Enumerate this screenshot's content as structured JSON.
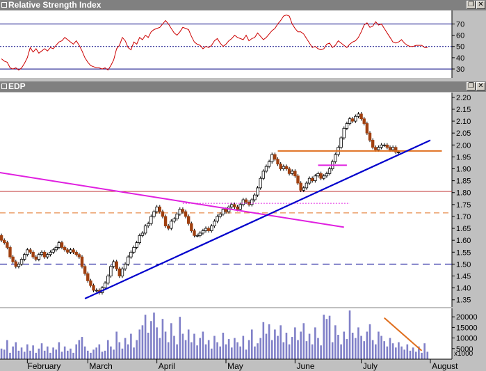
{
  "panes": {
    "rsi": {
      "title": "Relative Strength Index"
    },
    "price": {
      "title": "EDP"
    }
  },
  "window_buttons": {
    "restore": "❐",
    "close": "✕"
  },
  "colors": {
    "rsi_line": "#cc0000",
    "up_candle": "#ffffff",
    "down_candle": "#a04010",
    "trendline_blue": "#0000cc",
    "trendline_magenta": "#e020e0",
    "level_orange": "#e07020",
    "volume": "#8080c8"
  },
  "chart_data": [
    {
      "type": "line",
      "name": "rsi",
      "title": "Relative Strength Index",
      "ylim": [
        22,
        82
      ],
      "yticks": [
        "70",
        "60",
        "50",
        "40",
        "30"
      ],
      "ytick_values": [
        70,
        60,
        50,
        40,
        30
      ],
      "reference_lines": [
        {
          "value": 70,
          "style": "solid"
        },
        {
          "value": 50,
          "style": "dotted"
        },
        {
          "value": 30,
          "style": "solid"
        }
      ],
      "x": [
        1,
        2,
        3,
        4,
        5,
        6,
        7,
        8,
        9,
        10,
        11,
        12,
        13,
        14,
        15,
        16,
        17,
        18,
        19,
        20,
        21,
        22,
        23,
        24,
        25,
        26,
        27,
        28,
        29,
        30,
        31,
        32,
        33,
        34,
        35,
        36,
        37,
        38,
        39,
        40,
        41,
        42,
        43,
        44,
        45,
        46,
        47,
        48,
        49,
        50,
        51,
        52,
        53,
        54,
        55,
        56,
        57,
        58,
        59,
        60,
        61,
        62,
        63,
        64,
        65,
        66,
        67,
        68,
        69,
        70,
        71,
        72,
        73,
        74,
        75,
        76,
        77,
        78,
        79,
        80,
        81,
        82,
        83,
        84,
        85,
        86,
        87,
        88,
        89,
        90,
        91,
        92,
        93,
        94,
        95,
        96,
        97,
        98,
        99,
        100,
        101,
        102,
        103,
        104,
        105,
        106,
        107,
        108,
        109,
        110,
        111,
        112,
        113,
        114,
        115,
        116,
        117,
        118,
        119,
        120,
        121,
        122,
        123,
        124,
        125,
        126,
        127,
        128,
        129,
        130,
        131,
        132,
        133,
        134,
        135,
        136,
        137,
        138,
        139,
        140,
        141,
        142,
        143,
        144,
        145,
        146,
        147,
        148,
        149
      ],
      "values": [
        39,
        37,
        36,
        31,
        30,
        31,
        29,
        31,
        35,
        40,
        49,
        45,
        48,
        44,
        46,
        48,
        46,
        49,
        48,
        51,
        54,
        55,
        58,
        56,
        54,
        52,
        55,
        51,
        46,
        40,
        36,
        33,
        32,
        31,
        31,
        30,
        31,
        29,
        33,
        38,
        48,
        51,
        58,
        55,
        49,
        47,
        54,
        52,
        58,
        56,
        60,
        58,
        63,
        65,
        66,
        67,
        70,
        73,
        70,
        66,
        62,
        60,
        63,
        67,
        66,
        65,
        59,
        54,
        52,
        51,
        48,
        50,
        49,
        51,
        55,
        57,
        53,
        50,
        52,
        55,
        57,
        60,
        58,
        57,
        56,
        60,
        55,
        57,
        58,
        62,
        59,
        56,
        58,
        61,
        64,
        66,
        70,
        73,
        77,
        78,
        77,
        70,
        66,
        63,
        63,
        61,
        57,
        53,
        49,
        50,
        48,
        47,
        48,
        52,
        53,
        49,
        51,
        55,
        53,
        51,
        49,
        52,
        54,
        55,
        58,
        63,
        69,
        71,
        67,
        68,
        72,
        69,
        70,
        66,
        62,
        58,
        54,
        53,
        54,
        56,
        53,
        51,
        50,
        50,
        51,
        51,
        51,
        49,
        49
      ]
    },
    {
      "type": "candlestick",
      "name": "price",
      "title": "EDP",
      "ylim": [
        1.32,
        2.22
      ],
      "yticks": [
        "2.20",
        "2.15",
        "2.10",
        "2.05",
        "2.00",
        "1.95",
        "1.90",
        "1.85",
        "1.80",
        "1.75",
        "1.70",
        "1.65",
        "1.60",
        "1.55",
        "1.50",
        "1.45",
        "1.40",
        "1.35"
      ],
      "ytick_values": [
        2.2,
        2.15,
        2.1,
        2.05,
        2.0,
        1.95,
        1.9,
        1.85,
        1.8,
        1.75,
        1.7,
        1.65,
        1.6,
        1.55,
        1.5,
        1.45,
        1.4,
        1.35
      ],
      "x": [
        1,
        2,
        3,
        4,
        5,
        6,
        7,
        8,
        9,
        10,
        11,
        12,
        13,
        14,
        15,
        16,
        17,
        18,
        19,
        20,
        21,
        22,
        23,
        24,
        25,
        26,
        27,
        28,
        29,
        30,
        31,
        32,
        33,
        34,
        35,
        36,
        37,
        38,
        39,
        40,
        41,
        42,
        43,
        44,
        45,
        46,
        47,
        48,
        49,
        50,
        51,
        52,
        53,
        54,
        55,
        56,
        57,
        58,
        59,
        60,
        61,
        62,
        63,
        64,
        65,
        66,
        67,
        68,
        69,
        70,
        71,
        72,
        73,
        74,
        75,
        76,
        77,
        78,
        79,
        80,
        81,
        82,
        83,
        84,
        85,
        86,
        87,
        88,
        89,
        90,
        91,
        92,
        93,
        94,
        95,
        96,
        97,
        98,
        99,
        100,
        101,
        102,
        103,
        104,
        105,
        106,
        107,
        108,
        109,
        110,
        111,
        112,
        113,
        114,
        115,
        116,
        117,
        118,
        119,
        120,
        121,
        122,
        123,
        124,
        125,
        126,
        127,
        128,
        129,
        130,
        131,
        132,
        133,
        134,
        135,
        136,
        137,
        138,
        139,
        140,
        141,
        142,
        143,
        144,
        145,
        146,
        147,
        148,
        149
      ],
      "open": [
        1.62,
        1.6,
        1.59,
        1.57,
        1.53,
        1.51,
        1.49,
        1.5,
        1.52,
        1.54,
        1.56,
        1.55,
        1.53,
        1.52,
        1.54,
        1.55,
        1.53,
        1.54,
        1.55,
        1.56,
        1.57,
        1.59,
        1.57,
        1.56,
        1.55,
        1.56,
        1.55,
        1.54,
        1.53,
        1.49,
        1.46,
        1.43,
        1.41,
        1.39,
        1.39,
        1.38,
        1.4,
        1.42,
        1.45,
        1.49,
        1.51,
        1.48,
        1.45,
        1.48,
        1.5,
        1.53,
        1.55,
        1.57,
        1.59,
        1.62,
        1.63,
        1.66,
        1.67,
        1.7,
        1.72,
        1.74,
        1.72,
        1.7,
        1.66,
        1.65,
        1.68,
        1.69,
        1.71,
        1.73,
        1.72,
        1.7,
        1.67,
        1.64,
        1.62,
        1.62,
        1.63,
        1.64,
        1.65,
        1.64,
        1.66,
        1.68,
        1.7,
        1.71,
        1.73,
        1.72,
        1.74,
        1.75,
        1.74,
        1.73,
        1.75,
        1.77,
        1.76,
        1.75,
        1.77,
        1.79,
        1.82,
        1.86,
        1.89,
        1.91,
        1.93,
        1.96,
        1.94,
        1.92,
        1.9,
        1.91,
        1.9,
        1.88,
        1.89,
        1.87,
        1.84,
        1.81,
        1.82,
        1.84,
        1.86,
        1.85,
        1.87,
        1.88,
        1.86,
        1.87,
        1.88,
        1.9,
        1.93,
        1.96,
        1.99,
        2.03,
        2.07,
        2.09,
        2.11,
        2.1,
        2.12,
        2.13,
        2.11,
        2.09,
        2.05,
        2.02,
        1.99,
        1.98,
        1.99,
        2.0,
        2.0,
        1.99,
        1.98,
        1.99,
        1.97
      ],
      "close": [
        1.6,
        1.59,
        1.57,
        1.53,
        1.51,
        1.49,
        1.5,
        1.52,
        1.54,
        1.56,
        1.55,
        1.53,
        1.52,
        1.54,
        1.55,
        1.53,
        1.54,
        1.55,
        1.56,
        1.57,
        1.59,
        1.57,
        1.56,
        1.55,
        1.56,
        1.55,
        1.54,
        1.53,
        1.49,
        1.46,
        1.43,
        1.41,
        1.39,
        1.39,
        1.38,
        1.4,
        1.42,
        1.45,
        1.49,
        1.51,
        1.48,
        1.45,
        1.48,
        1.5,
        1.53,
        1.55,
        1.57,
        1.59,
        1.62,
        1.63,
        1.66,
        1.67,
        1.7,
        1.72,
        1.74,
        1.72,
        1.7,
        1.66,
        1.65,
        1.68,
        1.69,
        1.71,
        1.73,
        1.72,
        1.7,
        1.67,
        1.64,
        1.62,
        1.62,
        1.63,
        1.64,
        1.65,
        1.64,
        1.66,
        1.68,
        1.7,
        1.71,
        1.73,
        1.72,
        1.74,
        1.75,
        1.74,
        1.73,
        1.75,
        1.77,
        1.76,
        1.75,
        1.77,
        1.79,
        1.82,
        1.86,
        1.89,
        1.91,
        1.93,
        1.96,
        1.94,
        1.92,
        1.9,
        1.91,
        1.9,
        1.88,
        1.89,
        1.87,
        1.84,
        1.81,
        1.82,
        1.84,
        1.86,
        1.85,
        1.87,
        1.88,
        1.86,
        1.87,
        1.88,
        1.9,
        1.93,
        1.96,
        1.99,
        2.03,
        2.07,
        2.09,
        2.11,
        2.1,
        2.12,
        2.13,
        2.11,
        2.09,
        2.05,
        2.02,
        1.99,
        1.98,
        1.99,
        2.0,
        2.0,
        1.99,
        1.98,
        1.99,
        1.97,
        1.97
      ]
    },
    {
      "type": "bar",
      "name": "volume",
      "ylim": [
        0,
        24000
      ],
      "yticks": [
        "20000",
        "15000",
        "10000",
        "5000"
      ],
      "ytick_values": [
        20000,
        15000,
        10000,
        5000
      ],
      "scale_label": "x1000",
      "values": [
        5000,
        4500,
        9000,
        3000,
        6000,
        8000,
        4000,
        5500,
        3500,
        7000,
        4000,
        6500,
        3000,
        5000,
        7500,
        4000,
        6000,
        3000,
        5500,
        4500,
        8000,
        3500,
        6000,
        4000,
        5000,
        3000,
        7000,
        9000,
        10500,
        6000,
        4000,
        3000,
        4500,
        5500,
        7000,
        3500,
        4000,
        9000,
        6000,
        4500,
        13000,
        8000,
        5000,
        10000,
        7000,
        12000,
        5500,
        9000,
        14000,
        16000,
        21000,
        12500,
        18000,
        22000,
        15000,
        10000,
        19000,
        13000,
        8000,
        17000,
        11000,
        7000,
        20000,
        12000,
        9000,
        14000,
        8000,
        12000,
        6500,
        10000,
        13000,
        7000,
        9000,
        5000,
        11000,
        8000,
        6000,
        12500,
        7000,
        9500,
        5500,
        10000,
        8000,
        6000,
        11000,
        4500,
        9000,
        14000,
        6000,
        7500,
        10000,
        17500,
        12000,
        16500,
        9000,
        14000,
        11000,
        16000,
        8000,
        12500,
        7000,
        10500,
        15000,
        9000,
        13000,
        17000,
        8500,
        12000,
        7000,
        15000,
        10000,
        6500,
        21000,
        19000,
        20500,
        8000,
        16000,
        11500,
        7000,
        13000,
        9500,
        23000,
        12500,
        10000,
        15000,
        11000,
        8500,
        13000,
        16500,
        9000,
        7000,
        13000,
        11000,
        8500,
        6000,
        10000,
        7500,
        5500,
        8000,
        6000,
        4500,
        7000,
        4000,
        5500,
        3500,
        6000,
        3000,
        7500,
        3500
      ]
    }
  ],
  "x_axis": {
    "labels": [
      "February",
      "March",
      "April",
      "May",
      "June",
      "July",
      "August"
    ],
    "label_index": [
      10.5,
      32,
      56,
      80,
      104,
      127,
      151
    ],
    "tick_index": [
      10,
      31,
      55,
      79,
      103,
      126,
      150
    ],
    "xlim": [
      0.5,
      157.5
    ]
  },
  "annotations": {
    "blue_trendline": {
      "x1": 30,
      "y1": 1.355,
      "x2": 150,
      "y2": 2.02
    },
    "magenta_trendline": {
      "x1": 0,
      "y1": 1.885,
      "x2": 120,
      "y2": 1.655
    },
    "magenta_short": {
      "x1": 111,
      "y1": 1.915,
      "x2": 121,
      "y2": 1.915
    },
    "magenta_dotted": {
      "x1": 64,
      "y1": 1.755,
      "x2": 122,
      "y2": 1.755
    },
    "orange_resistance": {
      "x1": 97,
      "y1": 1.975,
      "x2": 154,
      "y2": 1.975
    },
    "red_support": {
      "value": 1.805
    },
    "orange_dashed": {
      "value": 1.715
    },
    "navy_dashed": {
      "value": 1.5
    },
    "volume_trend": {
      "x1": 134,
      "y1": 19500,
      "x2": 147,
      "y2": 4000
    }
  }
}
